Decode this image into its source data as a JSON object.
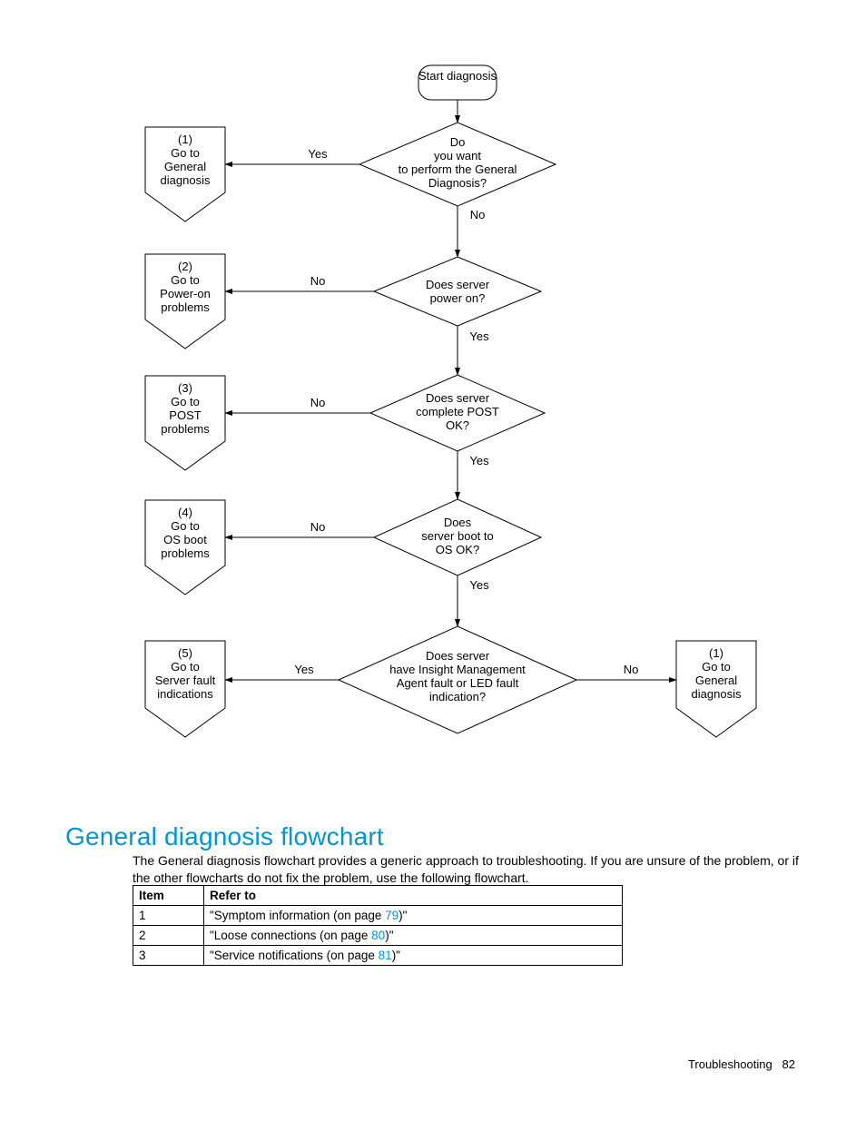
{
  "chart_data": {
    "type": "flowchart",
    "start": "Start diagnosis",
    "decisions": [
      {
        "id": "D1",
        "text": "Do you want to perform the General Diagnosis?",
        "yes_to": "O1",
        "no_to": "D2",
        "yes_label": "Yes",
        "no_label": "No"
      },
      {
        "id": "D2",
        "text": "Does server power on?",
        "yes_to": "D3",
        "no_to": "O2",
        "yes_label": "Yes",
        "no_label": "No"
      },
      {
        "id": "D3",
        "text": "Does server complete POST OK?",
        "yes_to": "D4",
        "no_to": "O3",
        "yes_label": "Yes",
        "no_label": "No"
      },
      {
        "id": "D4",
        "text": "Does server boot to OS OK?",
        "yes_to": "D5",
        "no_to": "O4",
        "yes_label": "Yes",
        "no_label": "No"
      },
      {
        "id": "D5",
        "text": "Does server have Insight Management Agent fault or LED fault indication?",
        "yes_to": "O5",
        "no_to": "O6",
        "yes_label": "Yes",
        "no_label": "No"
      }
    ],
    "offpage": [
      {
        "id": "O1",
        "num": "(1)",
        "text": "Go to General diagnosis"
      },
      {
        "id": "O2",
        "num": "(2)",
        "text": "Go to Power-on problems"
      },
      {
        "id": "O3",
        "num": "(3)",
        "text": "Go to POST problems"
      },
      {
        "id": "O4",
        "num": "(4)",
        "text": "Go to OS boot problems"
      },
      {
        "id": "O5",
        "num": "(5)",
        "text": "Go to Server fault indications"
      },
      {
        "id": "O6",
        "num": "(1)",
        "text": "Go to General diagnosis"
      }
    ],
    "labels": {
      "yes": "Yes",
      "no": "No"
    }
  },
  "heading": "General diagnosis flowchart",
  "body": "The General diagnosis flowchart provides a generic approach to troubleshooting. If you are unsure of the problem, or if the other flowcharts do not fix the problem, use the following flowchart.",
  "table": {
    "headers": {
      "item": "Item",
      "refer": "Refer to"
    },
    "rows": [
      {
        "item": "1",
        "pre": "\"Symptom information (on page ",
        "page": "79",
        "post": ")\""
      },
      {
        "item": "2",
        "pre": "\"Loose connections (on page ",
        "page": "80",
        "post": ")\""
      },
      {
        "item": "3",
        "pre": "\"Service notifications (on page ",
        "page": "81",
        "post": ")\""
      }
    ]
  },
  "footer": {
    "section": "Troubleshooting",
    "page": "82"
  }
}
